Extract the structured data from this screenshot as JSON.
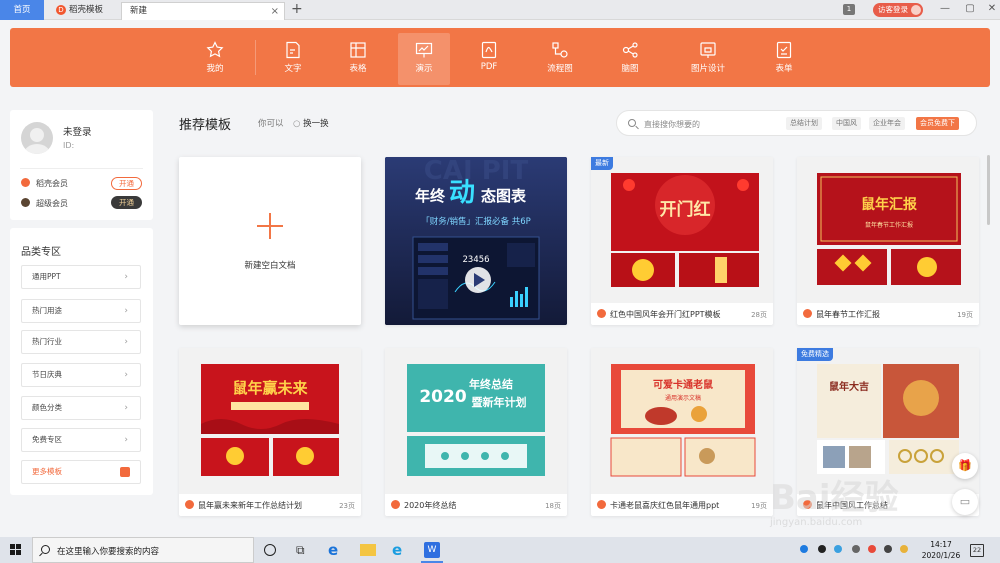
{
  "tabs": {
    "home": "首页",
    "daoke": "稻壳模板",
    "new": "新建",
    "close": "×",
    "plus": "+",
    "count": "1",
    "visitor_login": "访客登录",
    "win_controls": [
      "—",
      "▢",
      "✕"
    ]
  },
  "nav": {
    "items": [
      {
        "label": "我的",
        "icon": "star-icon"
      },
      {
        "label": "文字",
        "icon": "doc-icon"
      },
      {
        "label": "表格",
        "icon": "table-icon"
      },
      {
        "label": "演示",
        "icon": "presentation-icon",
        "active": true
      },
      {
        "label": "PDF",
        "icon": "pdf-icon"
      },
      {
        "label": "流程图",
        "icon": "flowchart-icon"
      },
      {
        "label": "脑图",
        "icon": "mindmap-icon"
      },
      {
        "label": "图片设计",
        "icon": "image-design-icon"
      },
      {
        "label": "表单",
        "icon": "form-icon"
      }
    ]
  },
  "user": {
    "name": "未登录",
    "id_label": "ID:",
    "memberships": [
      {
        "label": "稻壳会员",
        "button": "开通",
        "color": "#f26a3d"
      },
      {
        "label": "超级会员",
        "button": "开通",
        "color": "#7a5a3a"
      }
    ]
  },
  "categories": {
    "title": "品类专区",
    "items": [
      "通用PPT",
      "热门用途",
      "热门行业",
      "节日庆典",
      "颜色分类",
      "免费专区"
    ],
    "more": "更多模板"
  },
  "main": {
    "section_title": "推荐模板",
    "you_can": "你可以",
    "refresh": "换一换",
    "search_placeholder": "直接搜你想要的",
    "search_tags": [
      "总结计划",
      "中国风",
      "企业年会"
    ],
    "vip_tag": "会员免费下"
  },
  "new_doc_label": "新建空白文档",
  "featured": {
    "title_a": "年终",
    "title_b": "动",
    "title_c": "态图表",
    "subtitle": "「财务/销售」汇报必备   共6P",
    "number": "23456",
    "bg_text": "CAI PIT"
  },
  "templates": [
    {
      "title": "红色中国风年会开门红PPT模板",
      "pages": "28页",
      "badge": "最新",
      "thumb_text": "开门红"
    },
    {
      "title": "鼠年春节工作汇报",
      "pages": "19页",
      "badge": "",
      "thumb_text": "鼠年汇报",
      "thumb_sub": "鼠年春节工作汇报"
    },
    {
      "title": "鼠年赢未来新年工作总结计划",
      "pages": "23页",
      "badge": "",
      "thumb_text": "鼠年赢未来"
    },
    {
      "title": "2020年终总结",
      "pages": "18页",
      "badge": "",
      "thumb_text_a": "2020",
      "thumb_text_b": "年终总结",
      "thumb_text_c": "暨新年计划"
    },
    {
      "title": "卡通老鼠喜庆红色鼠年通用ppt",
      "pages": "19页",
      "badge": "",
      "thumb_text": "可爱卡通老鼠",
      "thumb_sub": "通用演示文稿"
    },
    {
      "title": "鼠年中国风工作总结",
      "pages": "",
      "badge": "免费精选",
      "thumb_text": "鼠年大吉"
    }
  ],
  "taskbar": {
    "search_placeholder": "在这里输入你要搜索的内容",
    "time": "14:17",
    "date": "2020/1/26",
    "notifications": "22"
  },
  "watermark": {
    "text": "Bai经验",
    "sub": "jingyan.baidu.com"
  }
}
